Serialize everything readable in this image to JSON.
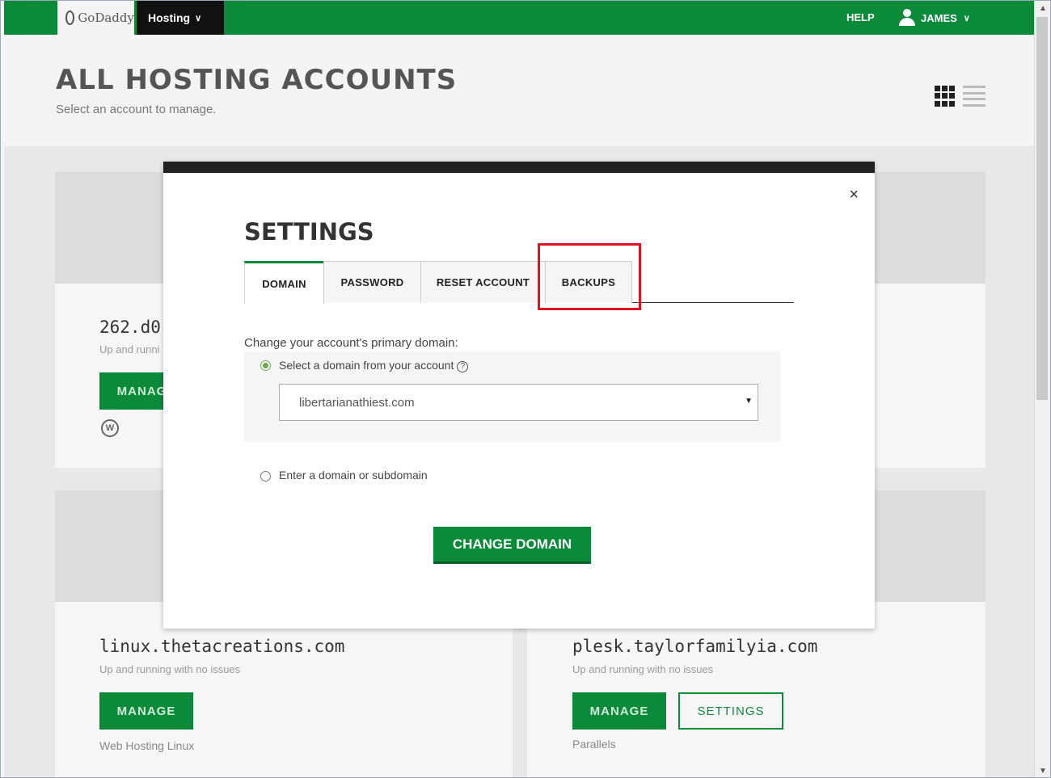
{
  "nav": {
    "logo_text": "GoDaddy",
    "product_tab": "Hosting",
    "help": "HELP",
    "user": "JAMES"
  },
  "header": {
    "title": "ALL HOSTING ACCOUNTS",
    "subtitle": "Select an account to manage."
  },
  "cards": [
    {
      "domain": "262.d0",
      "status": "Up and runni",
      "manage": "MANAGE"
    },
    {
      "domain": "linux.thetacreations.com",
      "status": "Up and running with no issues",
      "manage": "MANAGE",
      "plan": "Web Hosting Linux"
    },
    {
      "domain": "plesk.taylorfamilyia.com",
      "status": "Up and running with no issues",
      "manage": "MANAGE",
      "settings": "SETTINGS",
      "plan": "Parallels"
    }
  ],
  "modal": {
    "close": "×",
    "title": "SETTINGS",
    "tabs": [
      "DOMAIN",
      "PASSWORD",
      "RESET ACCOUNT",
      "BACKUPS"
    ],
    "active_tab": "DOMAIN",
    "prompt": "Change your account's primary domain:",
    "option_select_label": "Select a domain from your account",
    "selected_domain": "libertarianathiest.com",
    "option_enter_label": "Enter a domain or subdomain",
    "submit": "CHANGE DOMAIN"
  },
  "colors": {
    "brand_green": "#0b8a3a",
    "highlight_red": "#e0141e",
    "modal_top_bar": "#222222"
  },
  "icons": [
    "grid-view-icon",
    "list-view-icon",
    "user-icon",
    "help-icon",
    "close-icon",
    "wordpress-icon",
    "dropdown-caret-icon"
  ]
}
